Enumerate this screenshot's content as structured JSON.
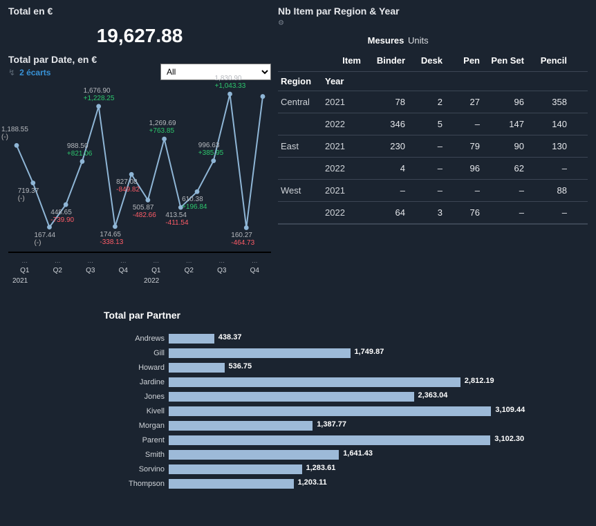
{
  "total_card": {
    "title": "Total en €",
    "value": "19,627.88"
  },
  "line_chart_section": {
    "title": "Total par Date, en €",
    "ecarts_label": "2 écarts",
    "filter": {
      "selected": "All",
      "options": [
        "All"
      ]
    }
  },
  "table_section": {
    "title": "Nb Item par Region & Year",
    "gear_icon_name": "gear-icon",
    "headers": {
      "mesures": "Mesures",
      "units": "Units",
      "item": "Item",
      "region": "Region",
      "year": "Year",
      "columns": [
        "Binder",
        "Desk",
        "Pen",
        "Pen Set",
        "Pencil"
      ]
    },
    "rows": [
      {
        "region": "Central",
        "year": "2021",
        "Binder": "78",
        "Desk": "2",
        "Pen": "27",
        "Pen Set": "96",
        "Pencil": "358"
      },
      {
        "region": "",
        "year": "2022",
        "Binder": "346",
        "Desk": "5",
        "Pen": "–",
        "Pen Set": "147",
        "Pencil": "140"
      },
      {
        "region": "East",
        "year": "2021",
        "Binder": "230",
        "Desk": "–",
        "Pen": "79",
        "Pen Set": "90",
        "Pencil": "130"
      },
      {
        "region": "",
        "year": "2022",
        "Binder": "4",
        "Desk": "–",
        "Pen": "96",
        "Pen Set": "62",
        "Pencil": "–"
      },
      {
        "region": "West",
        "year": "2021",
        "Binder": "–",
        "Desk": "–",
        "Pen": "–",
        "Pen Set": "–",
        "Pencil": "88"
      },
      {
        "region": "",
        "year": "2022",
        "Binder": "64",
        "Desk": "3",
        "Pen": "76",
        "Pen Set": "–",
        "Pencil": "–"
      }
    ]
  },
  "partner_chart_title": "Total par Partner",
  "chart_data": [
    {
      "type": "line",
      "title": "Total par Date, en €",
      "points": [
        {
          "x": "2021-m1",
          "label": "1,188.55",
          "sub": "(-)",
          "value": 1188.55
        },
        {
          "x": "2021-m2",
          "label": "719.37",
          "sub": "(-)",
          "value": 719.37
        },
        {
          "x": "2021-m3",
          "label": "167.44",
          "sub": "(-)",
          "value": 167.44
        },
        {
          "x": "2021-m4",
          "label": "448.65",
          "delta": "-739.90",
          "value": 448.65
        },
        {
          "x": "2021-m5",
          "label": "988.50",
          "delta": "+821.06",
          "value": 988.5
        },
        {
          "x": "2021-m6",
          "label": "1,676.90",
          "delta": "+1,228.25",
          "value": 1676.9
        },
        {
          "x": "2021-m7",
          "label": "174.65",
          "delta": "-338.13",
          "value": 174.65
        },
        {
          "x": "2021-m8",
          "label": "827.08",
          "delta": "-849.82",
          "value": 827.08
        },
        {
          "x": "2021-m9",
          "label": "505.87",
          "delta": "-482.66",
          "value": 505.87
        },
        {
          "x": "2021-m10",
          "label": "1,269.69",
          "delta": "+763.85",
          "value": 1269.69
        },
        {
          "x": "2022-m1",
          "label": "413.54",
          "delta": "-411.54",
          "value": 413.54
        },
        {
          "x": "2022-m2",
          "label": "610.38",
          "delta": "+196.84",
          "value": 610.38
        },
        {
          "x": "2022-m3",
          "label": "996.63",
          "delta": "+385.95",
          "value": 996.63
        },
        {
          "x": "2022-m4",
          "label": "1,830.90",
          "delta": "+1,043.33",
          "value": 1830.9
        },
        {
          "x": "2022-m5",
          "label": "160.27",
          "delta": "-464.73",
          "value": 160.27
        },
        {
          "x": "2022-m6",
          "value": 1800.0
        }
      ],
      "x_quarters": [
        {
          "year": "2021",
          "q": "Q1"
        },
        {
          "year": "",
          "q": "Q2"
        },
        {
          "year": "",
          "q": "Q3"
        },
        {
          "year": "",
          "q": "Q4"
        },
        {
          "year": "2022",
          "q": "Q1"
        },
        {
          "year": "",
          "q": "Q2"
        },
        {
          "year": "",
          "q": "Q3"
        },
        {
          "year": "",
          "q": "Q4"
        }
      ],
      "y_range": [
        0,
        1900
      ]
    },
    {
      "type": "bar",
      "title": "Total par Partner",
      "orientation": "horizontal",
      "x_range": [
        0,
        3200
      ],
      "categories": [
        "Andrews",
        "Gill",
        "Howard",
        "Jardine",
        "Jones",
        "Kivell",
        "Morgan",
        "Parent",
        "Smith",
        "Sorvino",
        "Thompson"
      ],
      "values": [
        438.37,
        1749.87,
        536.75,
        2812.19,
        2363.04,
        3109.44,
        1387.77,
        3102.3,
        1641.43,
        1283.61,
        1203.11
      ],
      "labels": [
        "438.37",
        "1,749.87",
        "536.75",
        "2,812.19",
        "2,363.04",
        "3,109.44",
        "1,387.77",
        "3,102.30",
        "1,641.43",
        "1,283.61",
        "1,203.11"
      ]
    }
  ]
}
